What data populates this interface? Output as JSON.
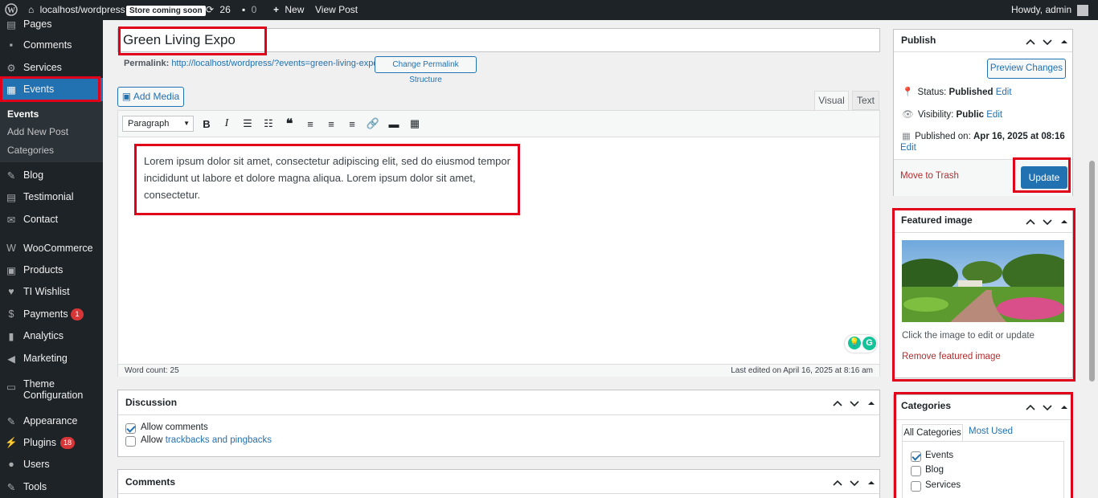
{
  "adminbar": {
    "site": "localhost/wordpress",
    "store_badge": "Store coming soon",
    "updates": "26",
    "comments": "0",
    "new": "New",
    "view_post": "View Post",
    "howdy": "Howdy, admin"
  },
  "sidebar": {
    "items": [
      {
        "label": "Pages",
        "icon": "pages-icon"
      },
      {
        "label": "Comments",
        "icon": "comments-icon"
      },
      {
        "label": "Services",
        "icon": "gear-icon"
      },
      {
        "label": "Events",
        "icon": "events-icon"
      },
      {
        "label": "Blog",
        "icon": "blog-icon"
      },
      {
        "label": "Testimonial",
        "icon": "testimonial-icon"
      },
      {
        "label": "Contact",
        "icon": "mail-icon"
      },
      {
        "label": "WooCommerce",
        "icon": "woo-icon"
      },
      {
        "label": "Products",
        "icon": "products-icon"
      },
      {
        "label": "TI Wishlist",
        "icon": "heart-icon"
      },
      {
        "label": "Payments",
        "icon": "dollar-icon",
        "count": "1"
      },
      {
        "label": "Analytics",
        "icon": "analytics-icon"
      },
      {
        "label": "Marketing",
        "icon": "megaphone-icon"
      },
      {
        "label": "Theme Configuration",
        "icon": "monitor-icon"
      },
      {
        "label": "Appearance",
        "icon": "brush-icon"
      },
      {
        "label": "Plugins",
        "icon": "plug-icon",
        "count": "18"
      },
      {
        "label": "Users",
        "icon": "user-icon"
      },
      {
        "label": "Tools",
        "icon": "wrench-icon"
      }
    ],
    "submenu": [
      "Events",
      "Add New Post",
      "Categories"
    ]
  },
  "editor": {
    "title": "Green Living Expo",
    "permalink_label": "Permalink:",
    "permalink_url": "http://localhost/wordpress/?events=green-living-expo",
    "change_permalink": "Change Permalink Structure",
    "add_media": "Add Media",
    "tab_visual": "Visual",
    "tab_text": "Text",
    "format": "Paragraph",
    "content_lines": [
      "Lorem ipsum dolor sit amet, consectetur adipiscing elit, sed do eiusmod tempor",
      "incididunt ut labore et dolore magna aliqua. Lorem ipsum dolor sit amet,",
      "consectetur."
    ],
    "word_count": "Word count: 25",
    "last_edited": "Last edited on April 16, 2025 at 8:16 am"
  },
  "discussion": {
    "title": "Discussion",
    "allow_comments": "Allow comments",
    "allow_prefix": "Allow ",
    "trackbacks": "trackbacks and pingbacks"
  },
  "comments_box": {
    "title": "Comments"
  },
  "publish": {
    "title": "Publish",
    "preview": "Preview Changes",
    "status_label": "Status:",
    "status_value": "Published",
    "edit": "Edit",
    "visibility_label": "Visibility:",
    "visibility_value": "Public",
    "published_label": "Published on:",
    "published_value": "Apr 16, 2025 at 08:16",
    "trash": "Move to Trash",
    "update": "Update"
  },
  "featured": {
    "title": "Featured image",
    "hint": "Click the image to edit or update",
    "remove": "Remove featured image"
  },
  "categories": {
    "title": "Categories",
    "tab_all": "All Categories",
    "tab_used": "Most Used",
    "items": [
      {
        "label": "Events",
        "checked": true
      },
      {
        "label": "Blog",
        "checked": false
      },
      {
        "label": "Services",
        "checked": false
      }
    ]
  },
  "colors": {
    "accent": "#2271b1",
    "highlight": "#e0001a",
    "sidebar_bg": "#1d2327"
  }
}
